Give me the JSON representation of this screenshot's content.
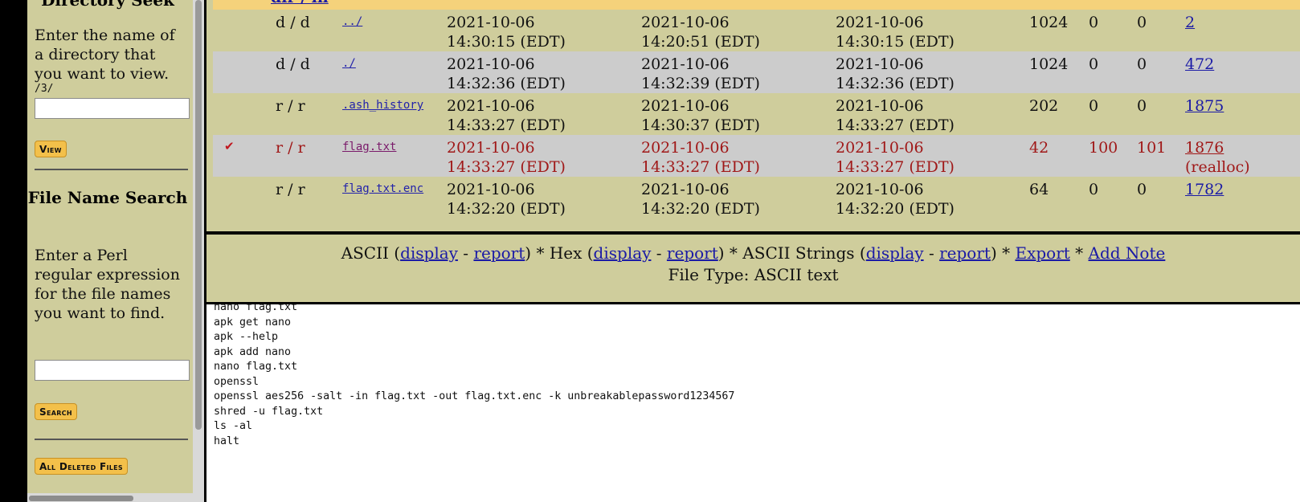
{
  "sidebar": {
    "directory_seek_title": "Directory Seek",
    "directory_seek_desc": "Enter the name of a directory that you want to view.",
    "directory_path": "/3/",
    "directory_input_value": "",
    "view_button": "View",
    "file_name_search_title": "File Name Search",
    "file_name_search_desc": "Enter a Perl regular expression for the file names you want to find.",
    "search_input_value": "",
    "search_button": "Search",
    "all_deleted_button": "All Deleted Files"
  },
  "listing": {
    "header_link": "dir / in",
    "rows": [
      {
        "type": "d / d",
        "name": "../",
        "crtime_date": "2021-10-06",
        "crtime_time": "14:30:15 (EDT)",
        "atime_date": "2021-10-06",
        "atime_time": "14:20:51 (EDT)",
        "mtime_date": "2021-10-06",
        "mtime_time": "14:30:15 (EDT)",
        "size": "1024",
        "uid": "0",
        "gid": "0",
        "meta": "2",
        "note": "",
        "deleted": false
      },
      {
        "type": "d / d",
        "name": "./",
        "crtime_date": "2021-10-06",
        "crtime_time": "14:32:36 (EDT)",
        "atime_date": "2021-10-06",
        "atime_time": "14:32:39 (EDT)",
        "mtime_date": "2021-10-06",
        "mtime_time": "14:32:36 (EDT)",
        "size": "1024",
        "uid": "0",
        "gid": "0",
        "meta": "472",
        "note": "",
        "deleted": false
      },
      {
        "type": "r / r",
        "name": ".ash_history",
        "crtime_date": "2021-10-06",
        "crtime_time": "14:33:27 (EDT)",
        "atime_date": "2021-10-06",
        "atime_time": "14:30:37 (EDT)",
        "mtime_date": "2021-10-06",
        "mtime_time": "14:33:27 (EDT)",
        "size": "202",
        "uid": "0",
        "gid": "0",
        "meta": "1875",
        "note": "",
        "deleted": false
      },
      {
        "type": "r / r",
        "name": "flag.txt",
        "crtime_date": "2021-10-06",
        "crtime_time": "14:33:27 (EDT)",
        "atime_date": "2021-10-06",
        "atime_time": "14:33:27 (EDT)",
        "mtime_date": "2021-10-06",
        "mtime_time": "14:33:27 (EDT)",
        "size": "42",
        "uid": "100",
        "gid": "101",
        "meta": "1876",
        "note": "(realloc)",
        "deleted": true,
        "check": "✔"
      },
      {
        "type": "r / r",
        "name": "flag.txt.enc",
        "crtime_date": "2021-10-06",
        "crtime_time": "14:32:20 (EDT)",
        "atime_date": "2021-10-06",
        "atime_time": "14:32:20 (EDT)",
        "mtime_date": "2021-10-06",
        "mtime_time": "14:32:20 (EDT)",
        "size": "64",
        "uid": "0",
        "gid": "0",
        "meta": "1782",
        "note": "",
        "deleted": false
      }
    ]
  },
  "viewer": {
    "ascii_label": "ASCII",
    "hex_label": "Hex",
    "strings_label": "ASCII Strings",
    "display_link": "display",
    "report_link": "report",
    "export_link": "Export",
    "add_note_link": "Add Note",
    "file_type": "File Type: ASCII text"
  },
  "content": {
    "text": "nano flag.txt\napk get nano\napk --help\napk add nano\nnano flag.txt\nopenssl\nopenssl aes256 -salt -in flag.txt -out flag.txt.enc -k unbreakablepassword1234567\nshred -u flag.txt\nls -al\nhalt"
  }
}
